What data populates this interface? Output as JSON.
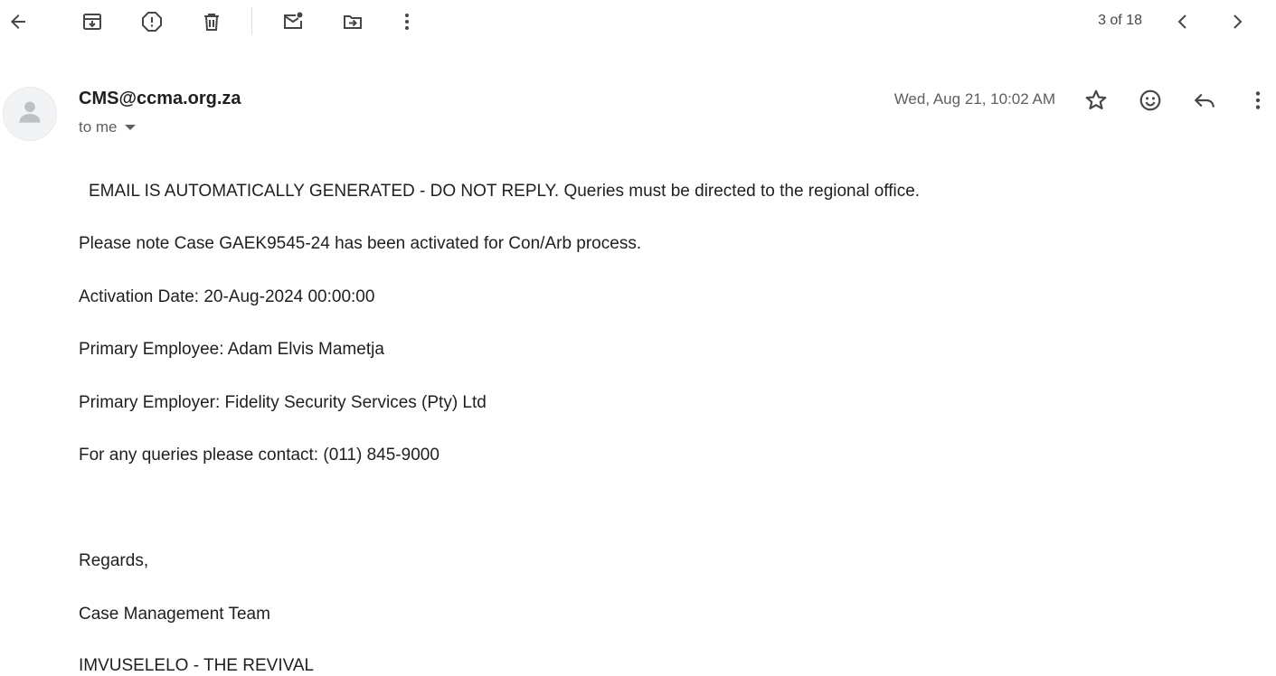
{
  "toolbar": {
    "back_icon": "arrow-left-icon",
    "archive_icon": "archive-icon",
    "report_spam_icon": "report-spam-icon",
    "delete_icon": "trash-icon",
    "mark_unread_icon": "mark-unread-icon",
    "move_to_icon": "move-to-folder-icon",
    "more_icon": "more-vert-icon",
    "pager_text": "3 of 18",
    "prev_icon": "chevron-left-icon",
    "next_icon": "chevron-right-icon"
  },
  "message": {
    "sender": "CMS@ccma.org.za",
    "recipient_label": "to me",
    "date": "Wed, Aug 21, 10:02 AM",
    "star_icon": "star-outline-icon",
    "emoji_icon": "emoji-icon",
    "reply_icon": "reply-icon",
    "more_icon": "more-vert-icon",
    "body": {
      "notice": "EMAIL IS AUTOMATICALLY GENERATED - DO NOT REPLY. Queries must be directed to the regional office.",
      "case_line": "Please note Case GAEK9545-24 has been activated for Con/Arb process.",
      "activation_date": "Activation Date: 20-Aug-2024 00:00:00",
      "primary_employee": "Primary Employee: Adam Elvis Mametja",
      "primary_employer": "Primary Employer: Fidelity Security Services (Pty) Ltd",
      "contact": "For any queries please contact: (011) 845-9000",
      "regards": "Regards,",
      "team": "Case Management Team",
      "tagline": "IMVUSELELO - THE REVIVAL"
    }
  },
  "colors": {
    "icon": "#444746",
    "text": "#1f1f1f",
    "muted": "#5e5e5e",
    "avatar_bg": "#f1f3f4"
  }
}
